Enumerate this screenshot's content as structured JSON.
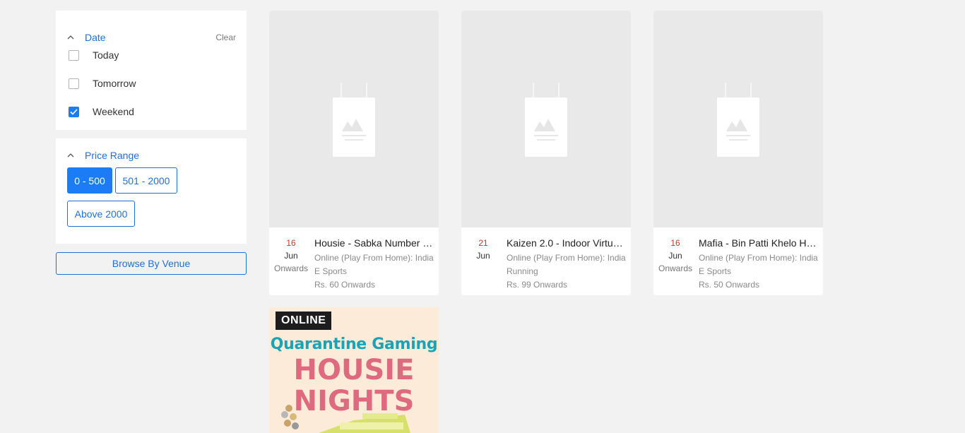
{
  "filters": {
    "date": {
      "title": "Date",
      "clear_label": "Clear",
      "options": [
        {
          "label": "Today",
          "checked": false
        },
        {
          "label": "Tomorrow",
          "checked": false
        },
        {
          "label": "Weekend",
          "checked": true
        }
      ]
    },
    "price": {
      "title": "Price Range",
      "options": [
        {
          "label": "0 - 500",
          "active": true
        },
        {
          "label": "501 - 2000",
          "active": false
        },
        {
          "label": "Above 2000",
          "active": false
        }
      ]
    },
    "browse_venue_label": "Browse By Venue"
  },
  "events": [
    {
      "day": "16",
      "month": "Jun",
      "onwards": "Onwards",
      "title": "Housie - Sabka Number …",
      "venue": "Online (Play From Home): India",
      "category": "E Sports",
      "price": "Rs. 60 Onwards"
    },
    {
      "day": "21",
      "month": "Jun",
      "onwards": "",
      "title": "Kaizen 2.0 - Indoor Virtua…",
      "venue": "Online (Play From Home): India",
      "category": "Running",
      "price": "Rs. 99 Onwards"
    },
    {
      "day": "16",
      "month": "Jun",
      "onwards": "Onwards",
      "title": "Mafia - Bin Patti Khelo Hu…",
      "venue": "Online (Play From Home): India",
      "category": "E Sports",
      "price": "Rs. 50 Onwards"
    }
  ],
  "poster": {
    "badge": "ONLINE",
    "subtitle": "Quarantine Gaming",
    "line1": "HOUSIE",
    "line2": "NIGHTS"
  },
  "colors": {
    "accent": "#1b7cf5",
    "link": "#1f6fd4",
    "date_day": "#c0392b",
    "poster_bg": "#fdebd9",
    "poster_teal": "#1aa4b3",
    "poster_pink": "#de6a80"
  }
}
